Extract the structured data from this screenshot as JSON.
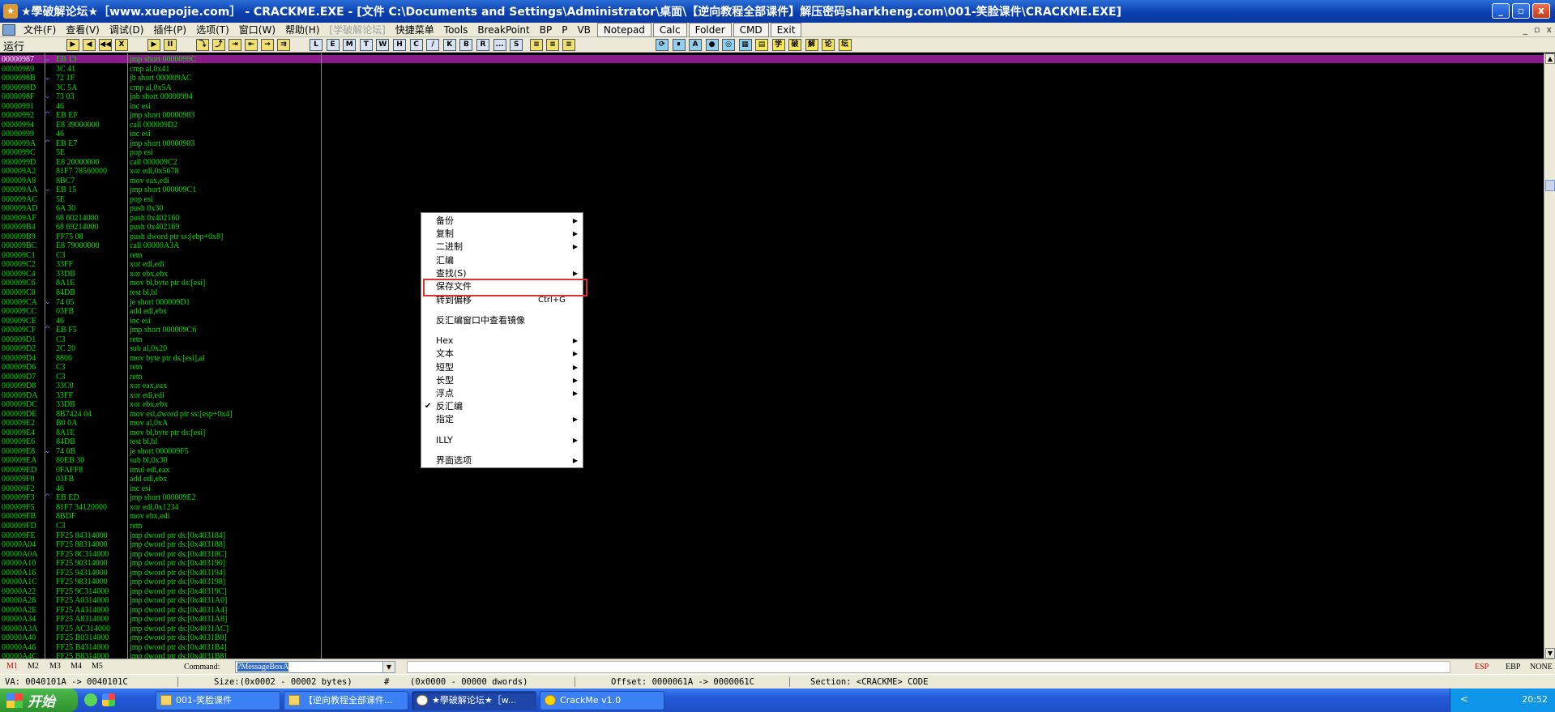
{
  "window": {
    "title": "★學破解论坛★［www.xuepojie.com］ - CRACKME.EXE - [文件 C:\\Documents and Settings\\Administrator\\桌面\\【逆向教程全部课件】解压密码sharkheng.com\\001-笑脸课件\\CRACKME.EXE]",
    "logo": "★",
    "minimize": "_",
    "restore": "▫",
    "close": "x"
  },
  "menubar": {
    "items": [
      "文件(F)",
      "查看(V)",
      "调试(D)",
      "插件(P)",
      "选项(T)",
      "窗口(W)",
      "帮助(H)"
    ],
    "disabled_item": "[学破解论坛]",
    "extra_items": [
      "快捷菜单",
      "Tools",
      "BreakPoint",
      "BP",
      "P",
      "VB"
    ],
    "boxed_items": [
      "Notepad",
      "Calc",
      "Folder",
      "CMD",
      "Exit"
    ],
    "mdi": [
      "_",
      "▫",
      "x"
    ]
  },
  "toolbar": {
    "status": "运行",
    "buttons_a": [
      "▶",
      "◀",
      "◀◀",
      "X",
      "▶",
      "II",
      "⤵",
      "⤴",
      "⇥",
      "⇤",
      "→",
      "⇉"
    ],
    "letters": [
      "L",
      "E",
      "M",
      "T",
      "W",
      "H",
      "C",
      "/",
      "K",
      "B",
      "R",
      "...",
      "S"
    ],
    "right_icons": [
      "⟳",
      "⏸",
      "A",
      "●",
      "◎",
      "▦",
      "▤",
      "学",
      "破",
      "解",
      "论",
      "坛"
    ]
  },
  "code": {
    "addresses": [
      "00000987",
      "00000989",
      "0000098B",
      "0000098D",
      "0000098F",
      "00000991",
      "00000992",
      "00000994",
      "00000999",
      "0000099A",
      "0000099C",
      "0000099D",
      "000009A2",
      "000009A8",
      "000009AA",
      "000009AC",
      "000009AD",
      "000009AF",
      "000009B4",
      "000009B9",
      "000009BC",
      "000009C1",
      "000009C2",
      "000009C4",
      "000009C6",
      "000009C8",
      "000009CA",
      "000009CC",
      "000009CE",
      "000009CF",
      "000009D1",
      "000009D2",
      "000009D4",
      "000009D6",
      "000009D7",
      "000009D8",
      "000009DA",
      "000009DC",
      "000009DE",
      "000009E2",
      "000009E4",
      "000009E6",
      "000009E8",
      "000009EA",
      "000009ED",
      "000009F0",
      "000009F2",
      "000009F3",
      "000009F5",
      "000009FB",
      "000009FD",
      "000009FE",
      "00000A04",
      "00000A0A",
      "00000A10",
      "00000A16",
      "00000A1C",
      "00000A22",
      "00000A28",
      "00000A2E",
      "00000A34",
      "00000A3A",
      "00000A40",
      "00000A46",
      "00000A4C"
    ],
    "arrows": [
      "⌄",
      "",
      "⌄",
      "",
      "⌄",
      "",
      "^",
      "",
      "",
      "^",
      "",
      "",
      "",
      "",
      "⌄",
      "",
      "",
      "",
      "",
      "",
      "",
      "",
      "",
      "",
      "",
      "",
      "⌄",
      "",
      "",
      "^",
      "",
      "",
      "",
      "",
      "",
      "",
      "",
      "",
      "",
      "",
      "",
      "",
      "⌄",
      "",
      "",
      "",
      "",
      "^",
      "",
      "",
      "",
      "",
      "",
      "",
      "",
      "",
      "",
      "",
      "",
      "",
      "",
      "",
      "",
      "",
      "",
      "",
      ""
    ],
    "hex": [
      "EB 13",
      "3C 41",
      "72 1F",
      "3C 5A",
      "73 03",
      "46",
      "EB EF",
      "E8 39000000",
      "46",
      "EB E7",
      "5E",
      "E8 20000000",
      "81F7 78560000",
      "8BC7",
      "EB 15",
      "5E",
      "6A 30",
      "68 60214000",
      "68 69214000",
      "FF75 08",
      "E8 79000000",
      "C3",
      "33FF",
      "33DB",
      "8A1E",
      "84DB",
      "74 05",
      "03FB",
      "46",
      "EB F5",
      "C3",
      "2C 20",
      "8806",
      "C3",
      "C3",
      "33C0",
      "33FF",
      "33DB",
      "8B7424 04",
      "B0 0A",
      "8A1E",
      "84DB",
      "74 0B",
      "80EB 30",
      "0FAFF8",
      "03FB",
      "46",
      "EB ED",
      "81F7 34120000",
      "8BDF",
      "C3",
      "FF25 84314000",
      "FF25 88314000",
      "FF25 8C314000",
      "FF25 90314000",
      "FF25 94314000",
      "FF25 98314000",
      "FF25 9C314000",
      "FF25 A0314000",
      "FF25 A4314000",
      "FF25 A8314000",
      "FF25 AC314000",
      "FF25 B0314000",
      "FF25 B4314000",
      "FF25 B8314000"
    ],
    "disasm": [
      "jmp short 0000099C",
      "cmp al,0x41",
      "jb short 000009AC",
      "cmp al,0x5A",
      "jnb short 00000994",
      "inc esi",
      "jmp short 00000983",
      "call 000009D2",
      "inc esi",
      "jmp short 00000983",
      "pop esi",
      "call 000009C2",
      "xor edi,0x5678",
      "mov eax,edi",
      "jmp short 000009C1",
      "pop esi",
      "push 0x30",
      "push 0x402160",
      "push 0x402169",
      "push dword ptr ss:[ebp+0x8]",
      "call 00000A3A",
      "retn",
      "xor edi,edi",
      "xor ebx,ebx",
      "mov bl,byte ptr ds:[esi]",
      "test bl,bl",
      "je short 000009D1",
      "add edi,ebx",
      "inc esi",
      "jmp short 000009C6",
      "retn",
      "sub al,0x20",
      "mov byte ptr ds:[esi],al",
      "retn",
      "retn",
      "xor eax,eax",
      "xor edi,edi",
      "xor ebx,ebx",
      "mov esi,dword ptr ss:[esp+0x4]",
      "mov al,0xA",
      "mov bl,byte ptr ds:[esi]",
      "test bl,bl",
      "je short 000009F5",
      "sub bl,0x30",
      "imul edi,eax",
      "add edi,ebx",
      "inc esi",
      "jmp short 000009E2",
      "xor edi,0x1234",
      "mov ebx,edi",
      "retn",
      "jmp dword ptr ds:[0x403184]",
      "jmp dword ptr ds:[0x403188]",
      "jmp dword ptr ds:[0x40318C]",
      "jmp dword ptr ds:[0x403190]",
      "jmp dword ptr ds:[0x403194]",
      "jmp dword ptr ds:[0x403198]",
      "jmp dword ptr ds:[0x40319C]",
      "jmp dword ptr ds:[0x4031A0]",
      "jmp dword ptr ds:[0x4031A4]",
      "jmp dword ptr ds:[0x4031A8]",
      "jmp dword ptr ds:[0x4031AC]",
      "jmp dword ptr ds:[0x4031B0]",
      "jmp dword ptr ds:[0x4031B4]",
      "jmp dword ptr ds:[0x4031B8]"
    ]
  },
  "context_menu": {
    "items": [
      {
        "label": "备份",
        "sub": true
      },
      {
        "label": "复制",
        "sub": true
      },
      {
        "label": "二进制",
        "sub": true
      },
      {
        "label": "汇编"
      },
      {
        "label": "查找(S)",
        "sub": true
      },
      {
        "label": "保存文件",
        "highlighted": true
      },
      {
        "label": "转到偏移",
        "shortcut": "Ctrl+G"
      },
      {
        "sep": true
      },
      {
        "label": "反汇编窗口中查看镜像"
      },
      {
        "sep": true
      },
      {
        "label": "Hex",
        "sub": true
      },
      {
        "label": "文本",
        "sub": true
      },
      {
        "label": "短型",
        "sub": true
      },
      {
        "label": "长型",
        "sub": true
      },
      {
        "label": "浮点",
        "sub": true
      },
      {
        "label": "反汇编",
        "checked": true
      },
      {
        "label": "指定",
        "sub": true
      },
      {
        "sep": true
      },
      {
        "label": "ILLY",
        "sub": true
      },
      {
        "sep": true
      },
      {
        "label": "界面选项",
        "sub": true
      }
    ],
    "highlight_color": "#e03030"
  },
  "command_bar": {
    "tabs": [
      "M1",
      "M2",
      "M3",
      "M4",
      "M5"
    ],
    "active_tab": "M1",
    "label": "Command:",
    "value": "?MessageBoxA",
    "registers": [
      "ESP",
      "EBP",
      "NONE"
    ],
    "active_register": "ESP"
  },
  "statusbar": {
    "va": "VA: 0040101A -> 0040101C",
    "size": "Size:(0x0002 - 00002 bytes)",
    "hash": "#",
    "dwords": "(0x0000 - 00000 dwords)",
    "offset": "Offset: 0000061A -> 0000061C",
    "section": "Section: <CRACKME> CODE"
  },
  "taskbar": {
    "start": "开始",
    "tasks": [
      {
        "label": "001-笑脸课件"
      },
      {
        "label": "【逆向教程全部课件..."
      },
      {
        "label": "★學破解论坛★［w...",
        "active": true
      },
      {
        "label": "CrackMe v1.0"
      }
    ],
    "tray_chevron": "<",
    "clock": "20:52"
  },
  "colors": {
    "code_text": "#00e000",
    "code_bg": "#000000",
    "selection": "#8a1b8a",
    "jump_arrow": "#6070ff",
    "titlebar": "#0a3fb0",
    "taskbar": "#2359d6"
  }
}
